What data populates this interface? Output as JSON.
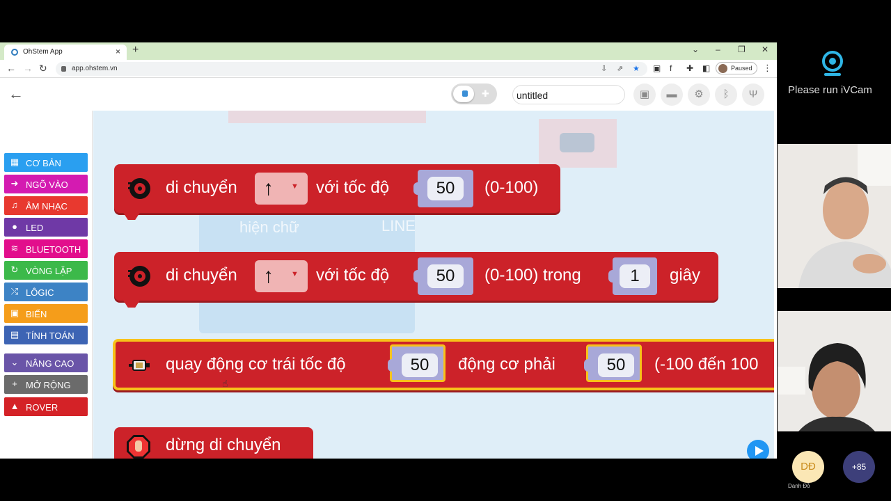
{
  "browser": {
    "tab_title": "OhStem App",
    "url": "app.ohstem.vn",
    "profile_status": "Paused"
  },
  "app": {
    "filename": "untitled"
  },
  "categories": [
    {
      "label": "CƠ BẢN",
      "color": "#2a9ff0",
      "icon": "grid-icon",
      "glyph": "▦"
    },
    {
      "label": "NGÕ VÀO",
      "color": "#d41bb1",
      "icon": "input-icon",
      "glyph": "➜"
    },
    {
      "label": "ÂM NHẠC",
      "color": "#e8392f",
      "icon": "music-icon",
      "glyph": "♫"
    },
    {
      "label": "LED",
      "color": "#6f39a6",
      "icon": "bulb-icon",
      "glyph": "●"
    },
    {
      "label": "BLUETOOTH",
      "color": "#e20e8c",
      "icon": "wifi-icon",
      "glyph": "≋"
    },
    {
      "label": "VÒNG LẶP",
      "color": "#3cb94a",
      "icon": "loop-icon",
      "glyph": "↻"
    },
    {
      "label": "LÔGIC",
      "color": "#3d83c5",
      "icon": "shuffle-icon",
      "glyph": "⤮"
    },
    {
      "label": "BIẾN",
      "color": "#f59d1a",
      "icon": "save-icon",
      "glyph": "▣"
    },
    {
      "label": "TÍNH TOÁN",
      "color": "#3d64b4",
      "icon": "calculator-icon",
      "glyph": "▤"
    },
    {
      "label": "NÂNG CAO",
      "color": "#6a55a8",
      "icon": "chevron-down-icon",
      "glyph": "⌄"
    },
    {
      "label": "MỞ RỘNG",
      "color": "#6b6b6b",
      "icon": "plus-icon",
      "glyph": "+"
    },
    {
      "label": "ROVER",
      "color": "#d42227",
      "icon": "road-icon",
      "glyph": "▲"
    }
  ],
  "blocks": {
    "move1": {
      "label": "di chuyển",
      "speed_label": "với tốc độ",
      "speed": "50",
      "range": "(0-100)"
    },
    "move2": {
      "label": "di chuyển",
      "speed_label": "với tốc độ",
      "speed": "50",
      "range_time": "(0-100) trong",
      "time": "1",
      "unit": "giây"
    },
    "motors": {
      "label": "quay động cơ trái tốc độ",
      "left": "50",
      "right_label": "động cơ phải",
      "right": "50",
      "range": "(-100 đến 100"
    },
    "stop": {
      "label": "dừng di chuyển"
    }
  },
  "ghost": {
    "text1": "hiện chữ",
    "text2": "LINE"
  },
  "call": {
    "ivcam_message": "Please run iVCam",
    "avatar_initials": "DĐ",
    "avatar_name": "Danh Đỗ",
    "more_count": "+85"
  }
}
